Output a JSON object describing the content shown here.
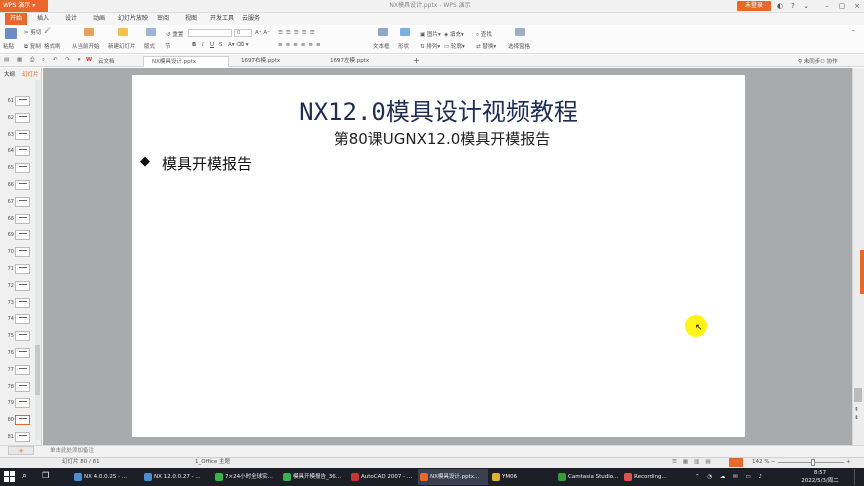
{
  "window": {
    "app_label": "WPS 演示",
    "title": "NX模具设计.pptx - WPS 演示",
    "login_label": "未登录"
  },
  "menu": [
    "开始",
    "插入",
    "设计",
    "动画",
    "幻灯片放映",
    "审阅",
    "视图",
    "开发工具",
    "云服务"
  ],
  "ribbon": {
    "paste": "粘贴",
    "cut": "剪切",
    "copy": "复制",
    "format_painter": "格式刷",
    "from_current": "从当前开始",
    "new_slide": "新建幻灯片",
    "layout": "版式",
    "section": "节",
    "reset": "重置",
    "font_size": "0",
    "text_box": "文本框",
    "shape": "形状",
    "arrange": "排列",
    "outline": "轮廓",
    "picture": "图片",
    "fill": "填充",
    "find": "查找",
    "replace": "替换",
    "select_pane": "选择窗格",
    "bold": "B",
    "italic": "I",
    "underline": "U",
    "shadow": "S"
  },
  "doc_tabs": {
    "cloud": "云文档",
    "tabs": [
      {
        "label": "NX模具设计.pptx",
        "active": true
      },
      {
        "label": "1697右模.pptx",
        "active": false
      },
      {
        "label": "1697左模.pptx",
        "active": false
      }
    ],
    "add": "+",
    "collab": "协作",
    "login_sync": "未同步"
  },
  "left_panel": {
    "tab_outline": "大纲",
    "tab_slides": "幻灯片",
    "slide_numbers": [
      "61",
      "62",
      "63",
      "64",
      "65",
      "66",
      "67",
      "68",
      "69",
      "70",
      "71",
      "72",
      "73",
      "74",
      "75",
      "76",
      "77",
      "78",
      "79",
      "80",
      "81"
    ],
    "selected": "80"
  },
  "slide": {
    "title": "NX12.0模具设计视频教程",
    "subtitle": "第80课UGNX12.0模具开模报告",
    "bullet_symbol": "◆",
    "bullet": "模具开模报告"
  },
  "notes": {
    "add": "+",
    "placeholder": "单击此处添加备注"
  },
  "status": {
    "slide_count": "幻灯片 80 / 81",
    "theme": "1_Office 主题",
    "zoom": "142 %",
    "minus": "−",
    "plus": "+"
  },
  "taskbar": {
    "items": [
      {
        "label": "NX 4.0.0.25 - ...",
        "color": "#4a8fd6"
      },
      {
        "label": "NX 12.0.0.27 - ...",
        "color": "#4a8fd6"
      },
      {
        "label": "7×24小时全球实...",
        "color": "#3bb34a"
      },
      {
        "label": "模具开模报告_36...",
        "color": "#3bb34a"
      },
      {
        "label": "AutoCAD 2007 - ...",
        "color": "#cc3333"
      },
      {
        "label": "NX模具设计.pptx...",
        "color": "#e8672a"
      },
      {
        "label": "YM06",
        "color": "#e0b030"
      },
      {
        "label": "Camtasia Studio...",
        "color": "#3a9a3a"
      },
      {
        "label": "Recording...",
        "color": "#d9534f"
      }
    ],
    "time": "8:57",
    "date": "2022/5/3/周二"
  }
}
